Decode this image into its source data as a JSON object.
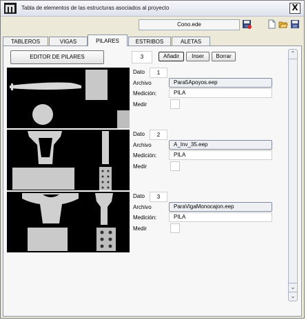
{
  "window": {
    "title": "Tabla de elementos de las estructuras asociados al proyecto",
    "close_glyph": "X"
  },
  "toolbar": {
    "file_name": "Cono.ede"
  },
  "tabs": [
    {
      "label": "TABLEROS"
    },
    {
      "label": "VIGAS"
    },
    {
      "label": "PILARES",
      "active": true
    },
    {
      "label": "ESTRIBOS"
    },
    {
      "label": "ALETAS"
    }
  ],
  "editor": {
    "title_label": "EDITOR DE PILARES",
    "count": "3",
    "add_label": "Añadir",
    "insert_label": "Inser",
    "delete_label": "Borrar"
  },
  "labels": {
    "dato": "Dato",
    "archivo": "Archivo",
    "medicion": "Medición:",
    "medir": "Medir"
  },
  "rows": [
    {
      "dato": "1",
      "archivo": "Para5Apoyos.eep",
      "medicion": "PILA",
      "medir": false
    },
    {
      "dato": "2",
      "archivo": "A_Inv_35.eep",
      "medicion": "PILA",
      "medir": false
    },
    {
      "dato": "3",
      "archivo": "ParaVigaMonocajon.eep",
      "medicion": "PILA",
      "medir": false
    }
  ],
  "scrollbar": {
    "up_glyph": "⌃",
    "down_glyph": "⌄",
    "double_down_glyph": "⌄"
  }
}
